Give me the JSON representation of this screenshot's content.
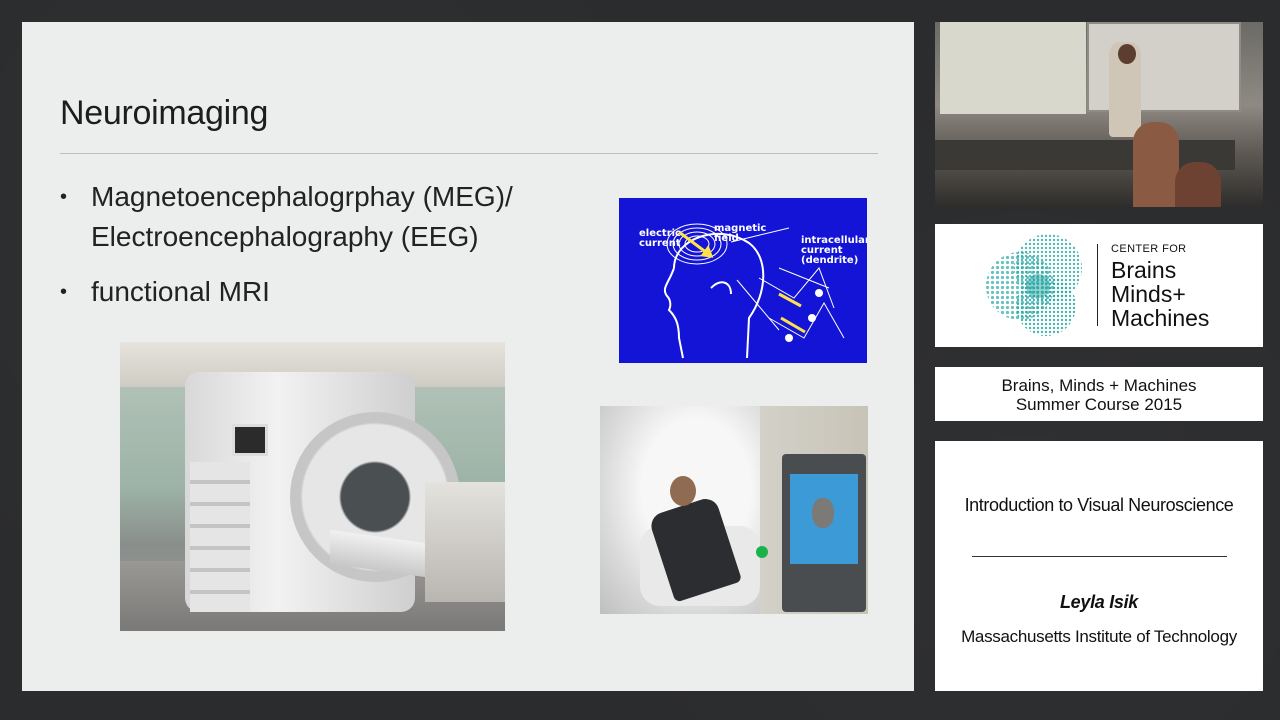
{
  "slide": {
    "title": "Neuroimaging",
    "bullets": [
      {
        "marker": "•",
        "lines": [
          "Magnetoencephalogrphay (MEG)/",
          "Electroencephalography (EEG)"
        ]
      },
      {
        "marker": "•",
        "lines": [
          "functional MRI"
        ]
      }
    ],
    "diagram_labels": {
      "electric_current": [
        "electric",
        "current"
      ],
      "magnetic_field": [
        "magnetic",
        "field"
      ],
      "intracellular_current": [
        "intracellular",
        "current",
        "(dendrite)"
      ]
    }
  },
  "sidebar": {
    "logo": {
      "small": "CENTER FOR",
      "lines": [
        "Brains",
        "Minds+",
        "Machines"
      ]
    },
    "course": [
      "Brains, Minds + Machines",
      "Summer Course 2015"
    ],
    "lecture": {
      "title": "Introduction to Visual Neuroscience",
      "speaker": "Leyla Isik",
      "institution": "Massachusetts Institute of Technology"
    }
  },
  "colors": {
    "slide_bg": "#eceeed",
    "page_bg": "#2b2c2e",
    "diagram_bg": "#1414d6",
    "logo_teal": "#2aa7a4"
  }
}
